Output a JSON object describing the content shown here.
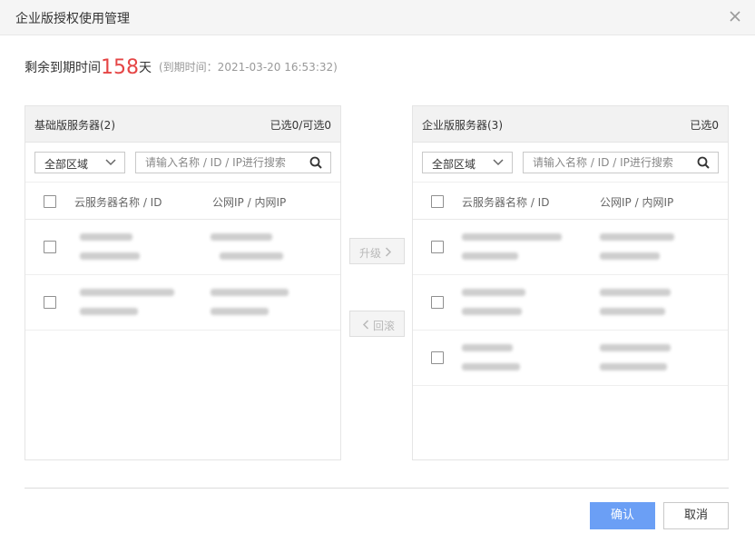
{
  "dialog": {
    "title": "企业版授权使用管理",
    "close_icon": "close-icon"
  },
  "remain": {
    "label": "剩余到期时间",
    "days": "158",
    "unit": "天",
    "expire": "(到期时间：2021-03-20 16:53:32)",
    "days_color": "#e54545"
  },
  "left_panel": {
    "title": "基础版服务器(2)",
    "count": "已选0/可选0",
    "region_select": "全部区域",
    "search_placeholder": "请输入名称 / ID / IP进行搜索",
    "col_name": "云服务器名称 / ID",
    "col_ip": "公网IP / 内网IP",
    "rows": 2
  },
  "right_panel": {
    "title": "企业版服务器(3)",
    "count": "已选0",
    "region_select": "全部区域",
    "search_placeholder": "请输入名称 / ID / IP进行搜索",
    "col_name": "云服务器名称 / ID",
    "col_ip": "公网IP / 内网IP",
    "rows": 3
  },
  "transfer": {
    "upgrade_label": "升级",
    "rollback_label": "回滚",
    "upgrade_icon": "chevron-right-icon",
    "rollback_icon": "chevron-left-icon"
  },
  "footer": {
    "confirm_label": "确认",
    "cancel_label": "取消",
    "confirm_color": "#6b9ff5"
  }
}
